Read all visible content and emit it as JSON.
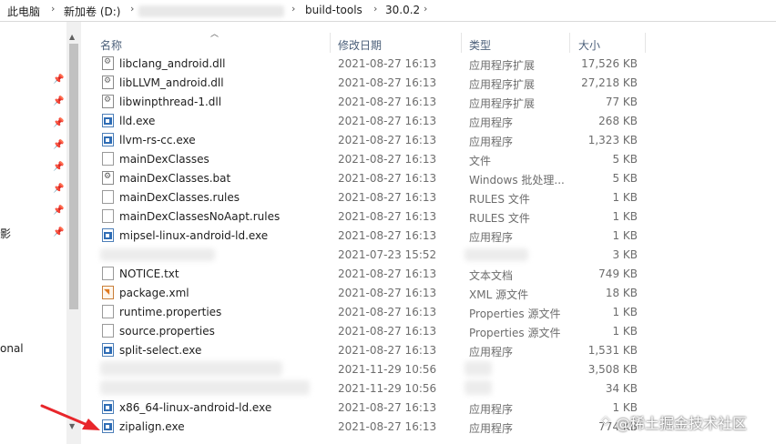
{
  "breadcrumb": {
    "items": [
      "此电脑",
      "新加卷 (D:)",
      "build-tools",
      "30.0.2"
    ],
    "separator": "›"
  },
  "nav": {
    "labels": [
      "影",
      "onal"
    ]
  },
  "columns": {
    "name": "名称",
    "date": "修改日期",
    "type": "类型",
    "size": "大小"
  },
  "files": [
    {
      "name": "libclang_android.dll",
      "date": "2021-08-27 16:13",
      "type": "应用程序扩展",
      "size": "17,526 KB",
      "icon": "dll-icon"
    },
    {
      "name": "libLLVM_android.dll",
      "date": "2021-08-27 16:13",
      "type": "应用程序扩展",
      "size": "27,218 KB",
      "icon": "dll-icon"
    },
    {
      "name": "libwinpthread-1.dll",
      "date": "2021-08-27 16:13",
      "type": "应用程序扩展",
      "size": "77 KB",
      "icon": "dll-icon"
    },
    {
      "name": "lld.exe",
      "date": "2021-08-27 16:13",
      "type": "应用程序",
      "size": "268 KB",
      "icon": "exe-icon"
    },
    {
      "name": "llvm-rs-cc.exe",
      "date": "2021-08-27 16:13",
      "type": "应用程序",
      "size": "1,323 KB",
      "icon": "exe-icon"
    },
    {
      "name": "mainDexClasses",
      "date": "2021-08-27 16:13",
      "type": "文件",
      "size": "5 KB",
      "icon": "file-icon"
    },
    {
      "name": "mainDexClasses.bat",
      "date": "2021-08-27 16:13",
      "type": "Windows 批处理...",
      "size": "5 KB",
      "icon": "bat-icon"
    },
    {
      "name": "mainDexClasses.rules",
      "date": "2021-08-27 16:13",
      "type": "RULES 文件",
      "size": "1 KB",
      "icon": "file-icon"
    },
    {
      "name": "mainDexClassesNoAapt.rules",
      "date": "2021-08-27 16:13",
      "type": "RULES 文件",
      "size": "1 KB",
      "icon": "file-icon"
    },
    {
      "name": "mipsel-linux-android-ld.exe",
      "date": "2021-08-27 16:13",
      "type": "应用程序",
      "size": "1 KB",
      "icon": "exe-icon"
    },
    {
      "name": "",
      "date": "2021-07-23 15:52",
      "type": "",
      "size": "3 KB",
      "icon": "blurred-icon"
    },
    {
      "name": "NOTICE.txt",
      "date": "2021-08-27 16:13",
      "type": "文本文档",
      "size": "749 KB",
      "icon": "file-icon"
    },
    {
      "name": "package.xml",
      "date": "2021-08-27 16:13",
      "type": "XML 源文件",
      "size": "18 KB",
      "icon": "xml-icon"
    },
    {
      "name": "runtime.properties",
      "date": "2021-08-27 16:13",
      "type": "Properties 源文件",
      "size": "1 KB",
      "icon": "file-icon"
    },
    {
      "name": "source.properties",
      "date": "2021-08-27 16:13",
      "type": "Properties 源文件",
      "size": "1 KB",
      "icon": "file-icon"
    },
    {
      "name": "split-select.exe",
      "date": "2021-08-27 16:13",
      "type": "应用程序",
      "size": "1,531 KB",
      "icon": "exe-icon"
    },
    {
      "name": "",
      "date": "2021-11-29 10:56",
      "type": "",
      "size": "3,508 KB",
      "icon": "blurred-icon"
    },
    {
      "name": "",
      "date": "2021-11-29 10:56",
      "type": "",
      "size": "34 KB",
      "icon": "blurred-icon"
    },
    {
      "name": "x86_64-linux-android-ld.exe",
      "date": "2021-08-27 16:13",
      "type": "应用程序",
      "size": "1 KB",
      "icon": "exe-icon"
    },
    {
      "name": "zipalign.exe",
      "date": "2021-08-27 16:13",
      "type": "应用程序",
      "size": "774 KB",
      "icon": "exe-icon"
    }
  ],
  "watermark": "@稀土掘金技术社区",
  "colors": {
    "header_text": "#4c607a",
    "annotation_arrow": "#e8262b"
  }
}
